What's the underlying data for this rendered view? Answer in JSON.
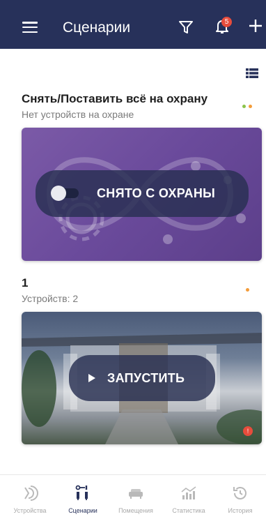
{
  "header": {
    "title": "Сценарии",
    "notification_count": "5"
  },
  "scenarios": [
    {
      "title": "Снять/Поставить всё на охрану",
      "subtitle": "Нет устройств на охране",
      "action_label": "СНЯТО С ОХРАНЫ"
    },
    {
      "title": "1",
      "subtitle": "Устройств: 2",
      "action_label": "ЗАПУСТИТЬ",
      "error_badge": "!"
    }
  ],
  "bottom_nav": [
    {
      "label": "Устройства",
      "icon": "devices-icon"
    },
    {
      "label": "Сценарии",
      "icon": "scenarios-icon"
    },
    {
      "label": "Помещения",
      "icon": "rooms-icon"
    },
    {
      "label": "Статистика",
      "icon": "statistics-icon"
    },
    {
      "label": "История",
      "icon": "history-icon"
    }
  ],
  "colors": {
    "header_bg": "#27315a",
    "status_green": "#8bc34a",
    "status_orange": "#f39c3a",
    "error_red": "#e74c3c"
  }
}
